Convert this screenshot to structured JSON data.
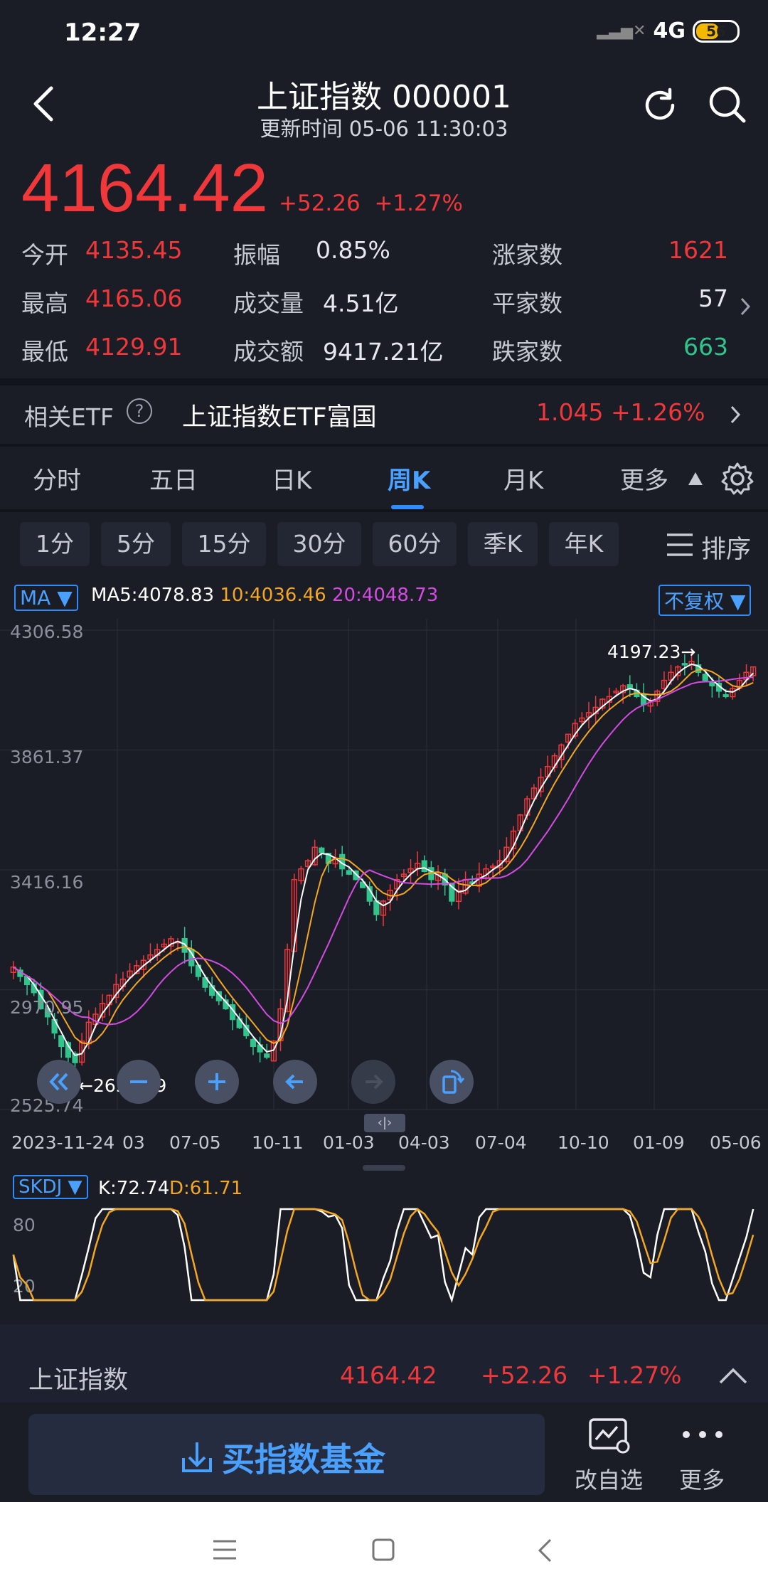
{
  "status": {
    "time": "12:27",
    "network": "4G",
    "battery": "56",
    "battery_level": 0.56
  },
  "header": {
    "title": "上证指数 000001",
    "subtitle": "更新时间 05-06 11:30:03"
  },
  "quote": {
    "price": "4164.42",
    "change": "+52.26",
    "change_pct": "+1.27%"
  },
  "stats": {
    "open_label": "今开",
    "open": "4135.45",
    "amp_label": "振幅",
    "amp": "0.85%",
    "up_label": "涨家数",
    "up": "1621",
    "high_label": "最高",
    "high": "4165.06",
    "vol_label": "成交量",
    "vol": "4.51亿",
    "flat_label": "平家数",
    "flat": "57",
    "low_label": "最低",
    "low": "4129.91",
    "amt_label": "成交额",
    "amt": "9417.21亿",
    "down_label": "跌家数",
    "down": "663"
  },
  "etf": {
    "label": "相关ETF",
    "name": "上证指数ETF富国",
    "price": "1.045",
    "pct": "+1.26%"
  },
  "tabs": [
    "分时",
    "五日",
    "日K",
    "周K",
    "月K",
    "更多"
  ],
  "subtabs": [
    "1分",
    "5分",
    "15分",
    "30分",
    "60分",
    "季K",
    "年K"
  ],
  "sort_label": "排序",
  "ma": {
    "name": "MA",
    "ma5": "MA5:4078.83",
    "ma10": "10:4036.46",
    "ma20": "20:4048.73",
    "adjust": "不复权"
  },
  "chart_data": {
    "type": "candlestick",
    "y_ticks": [
      "4306.58",
      "3861.37",
      "3416.16",
      "2970.95",
      "2525.74"
    ],
    "ylim": [
      2525.74,
      4306.58
    ],
    "x_ticks": [
      "2023-11-24",
      "03",
      "07-05",
      "10-11",
      "01-03",
      "04-03",
      "07-04",
      "10-10",
      "01-09",
      "05-06"
    ],
    "high_annotation": "4197.23→",
    "low_annotation": "←2635.09",
    "ma_colors": {
      "ma5": "#ffffff",
      "ma10": "#f5a623",
      "ma20": "#d34be0"
    },
    "up_color": "#f0383b",
    "down_color": "#31c48d",
    "close_series": [
      3055,
      3020,
      2990,
      2960,
      2900,
      2870,
      2810,
      2760,
      2720,
      2700,
      2780,
      2850,
      2880,
      2920,
      2950,
      2990,
      3010,
      3040,
      3060,
      3080,
      3100,
      3120,
      3140,
      3160,
      3150,
      3110,
      3060,
      3020,
      2980,
      2950,
      2930,
      2900,
      2860,
      2830,
      2800,
      2760,
      2740,
      2720,
      2780,
      2900,
      3120,
      3380,
      3420,
      3450,
      3500,
      3480,
      3440,
      3460,
      3420,
      3400,
      3380,
      3350,
      3300,
      3250,
      3300,
      3340,
      3380,
      3400,
      3420,
      3440,
      3410,
      3380,
      3400,
      3360,
      3300,
      3340,
      3380,
      3370,
      3400,
      3420,
      3430,
      3450,
      3500,
      3560,
      3620,
      3680,
      3720,
      3760,
      3800,
      3840,
      3880,
      3920,
      3960,
      3980,
      4000,
      4020,
      4050,
      4060,
      4080,
      4100,
      4090,
      4060,
      4030,
      4040,
      4080,
      4120,
      4150,
      4170,
      4180,
      4190,
      4150,
      4120,
      4100,
      4080,
      4060,
      4090,
      4120,
      4150,
      4170
    ]
  },
  "skdj": {
    "name": "SKDJ",
    "k": "K:72.74",
    "d": "D:61.71",
    "y_ticks": [
      "80",
      "20"
    ]
  },
  "bottom": {
    "name": "上证指数",
    "price": "4164.42",
    "change": "+52.26",
    "pct": "+1.27%",
    "buy_label": "买指数基金",
    "watch_label": "改自选",
    "more_label": "更多"
  }
}
